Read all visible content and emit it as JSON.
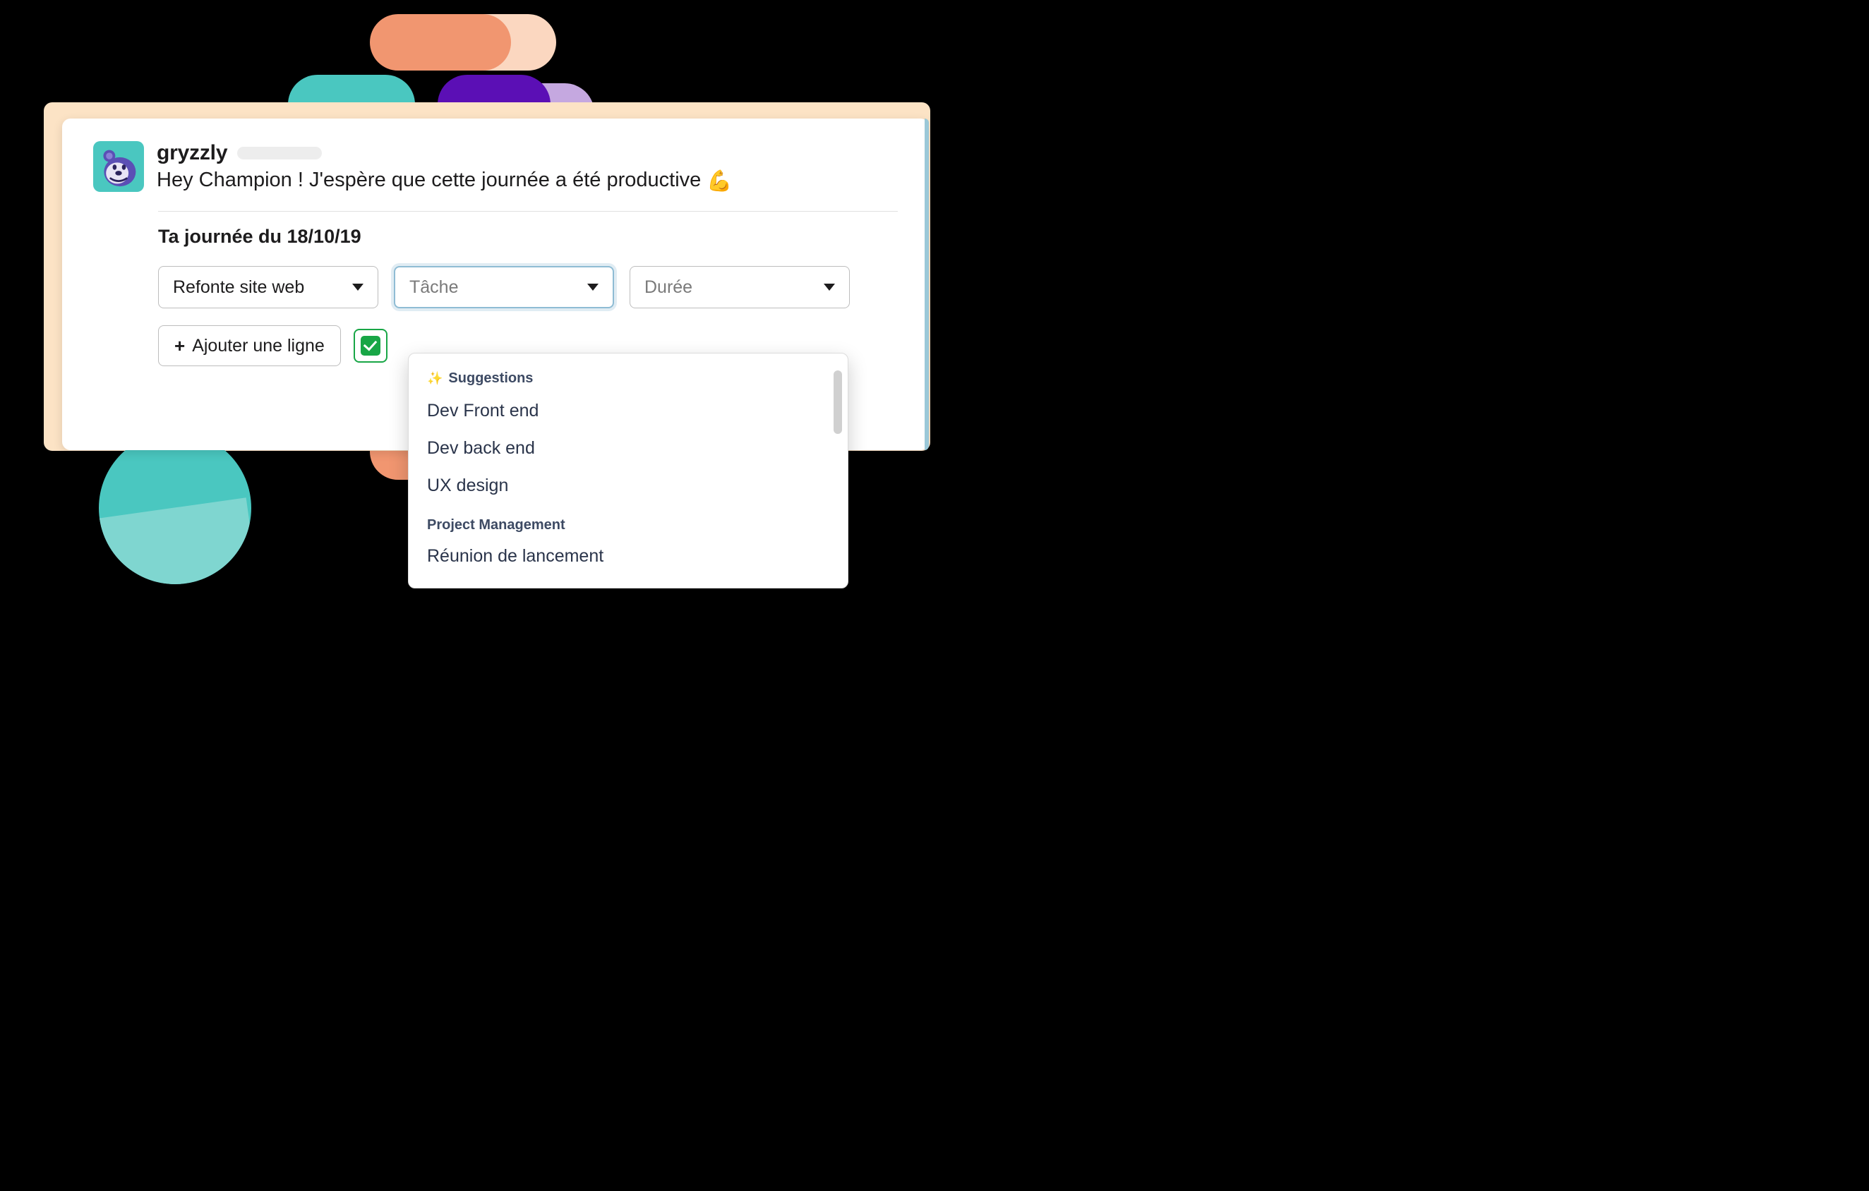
{
  "bot": {
    "name": "gryzzly",
    "greeting": "Hey Champion ! J'espère que cette journée a été productive",
    "emoji": "💪"
  },
  "section": {
    "title": "Ta journée du 18/10/19"
  },
  "dropdowns": {
    "project": {
      "value": "Refonte site web"
    },
    "task": {
      "placeholder": "Tâche"
    },
    "duration": {
      "placeholder": "Durée"
    }
  },
  "actions": {
    "add_line": "Ajouter une ligne"
  },
  "task_menu": {
    "groups": [
      {
        "title": "Suggestions",
        "sparkle": "✨",
        "items": [
          "Dev Front end",
          "Dev back end",
          "UX design"
        ]
      },
      {
        "title": "Project Management",
        "items": [
          "Réunion de lancement"
        ]
      }
    ]
  }
}
